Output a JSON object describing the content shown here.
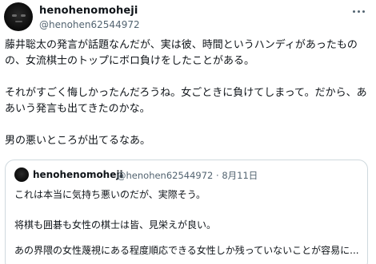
{
  "author": {
    "display_name": "henohenomoheji",
    "handle": "@henohen62544972",
    "avatar": "avatar-icon"
  },
  "tweet": {
    "text": "藤井聡太の発言が話題なんだが、実は彼、時間というハンディがあったものの、女流棋士のトップにボロ負けをしたことがある。\n\nそれがすごく悔しかったんだろうね。女ごときに負けてしまって。だから、ああいう発言も出てきたのかな。\n\n男の悪いところが出てるなあ。"
  },
  "quote": {
    "display_name": "henohenomoheji",
    "meta": "@henohen62544972 · 8月11日",
    "text": "これは本当に気持ち悪いのだが、実際そう。\n\n将棋も囲碁も女性の棋士は皆、見栄えが良い。",
    "text_last": "あの界隈の女性蔑視にある程度順応できる女性しか残っていないことが容易に..."
  },
  "icons": {
    "more": "more-icon"
  }
}
